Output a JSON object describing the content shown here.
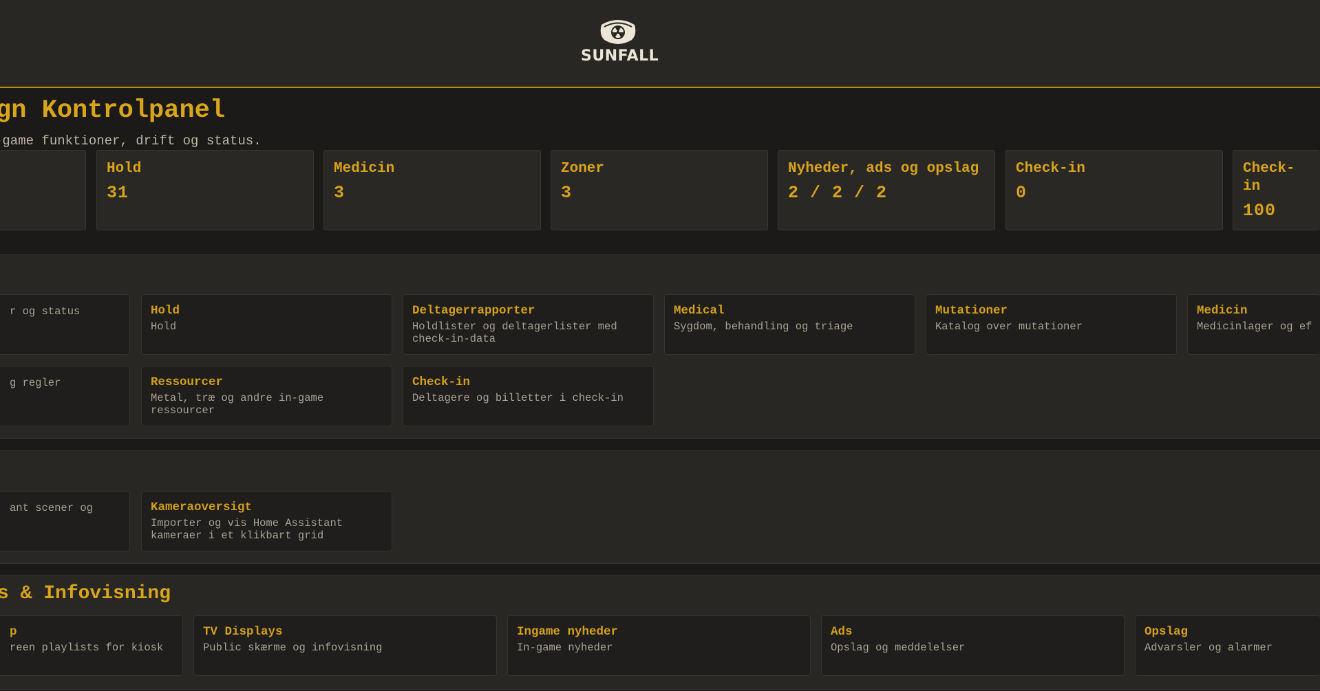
{
  "brand": {
    "name": "SUNFALL",
    "icon": "radiation-shield-icon"
  },
  "page": {
    "title": "gn Kontrolpanel",
    "subtitle": "-game funktioner, drift og status."
  },
  "stats": [
    {
      "label": "",
      "value": ""
    },
    {
      "label": "Hold",
      "value": "31"
    },
    {
      "label": "Medicin",
      "value": "3"
    },
    {
      "label": "Zoner",
      "value": "3"
    },
    {
      "label": "Nyheder, ads og opslag",
      "value": "2 / 2 / 2"
    },
    {
      "label": "Check-in",
      "value": "0"
    },
    {
      "label": "Check-in",
      "value": "100"
    }
  ],
  "sections": {
    "game": {
      "tiles": [
        {
          "title": "",
          "desc": "r og status"
        },
        {
          "title": "Hold",
          "desc": "Hold"
        },
        {
          "title": "Deltagerrapporter",
          "desc": "Holdlister og deltagerlister med check-in-data"
        },
        {
          "title": "Medical",
          "desc": "Sygdom, behandling og triage"
        },
        {
          "title": "Mutationer",
          "desc": "Katalog over mutationer"
        },
        {
          "title": "Medicin",
          "desc": "Medicinlager og ef"
        },
        {
          "title": "",
          "desc": "g regler"
        },
        {
          "title": "Ressourcer",
          "desc": "Metal, træ og andre in-game ressourcer"
        },
        {
          "title": "Check-in",
          "desc": "Deltagere og billetter i check-in"
        }
      ]
    },
    "automation": {
      "tiles": [
        {
          "title": "",
          "desc": "ant scener og"
        },
        {
          "title": "Kameraoversigt",
          "desc": "Importer og vis Home Assistant kameraer i et klikbart grid"
        }
      ]
    },
    "displays": {
      "title": "s & Infovisning",
      "tiles": [
        {
          "title": "p",
          "desc": "reen playlists for kiosk"
        },
        {
          "title": "TV Displays",
          "desc": "Public skærme og infovisning"
        },
        {
          "title": "Ingame nyheder",
          "desc": "In-game nyheder"
        },
        {
          "title": "Ads",
          "desc": "Opslag og meddelelser"
        },
        {
          "title": "Opslag",
          "desc": "Advarsler og alarmer"
        }
      ]
    }
  }
}
